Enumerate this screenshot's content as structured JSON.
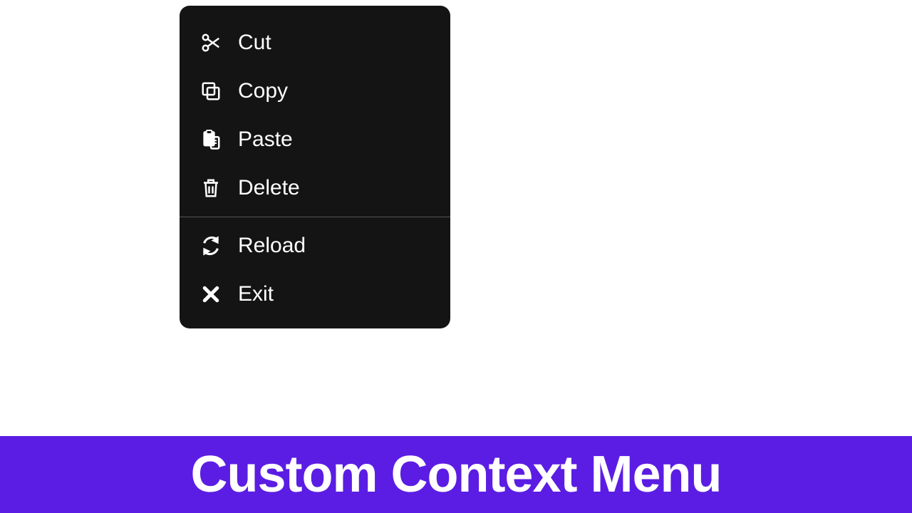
{
  "menu": {
    "items": [
      {
        "label": "Cut"
      },
      {
        "label": "Copy"
      },
      {
        "label": "Paste"
      },
      {
        "label": "Delete"
      },
      {
        "label": "Reload"
      },
      {
        "label": "Exit"
      }
    ]
  },
  "banner": {
    "title": "Custom Context Menu"
  }
}
